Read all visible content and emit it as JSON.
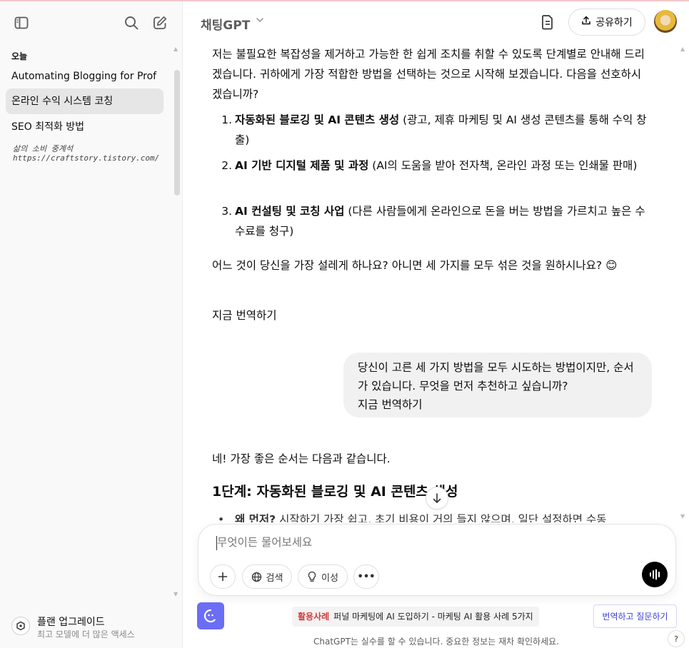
{
  "sidebar": {
    "section_today": "오늘",
    "items": [
      {
        "label": "Automating Blogging for Prof"
      },
      {
        "label": "온라인 수익 시스템 코칭"
      },
      {
        "label": "SEO 최적화 방법"
      }
    ],
    "watermark_line1": "삶의 소비 중계석",
    "watermark_line2": "https://craftstory.tistory.com/",
    "upgrade_title": "플랜 업그레이드",
    "upgrade_sub": "최고 모델에 더 많은 액세스"
  },
  "header": {
    "model": "채팅GPT",
    "share_label": "공유하기"
  },
  "chat": {
    "intro": "저는 불필요한 복잡성을 제거하고 가능한 한 쉽게 조치를 취할 수 있도록 단계별로 안내해 드리겠습니다. 귀하에게 가장 적합한 방법을 선택하는 것으로 시작해 보겠습니다. 다음을 선호하시겠습니까?",
    "options": [
      {
        "num": "1.",
        "bold": "자동화된 블로깅 및 AI 콘텐츠 생성",
        "rest": " (광고, 제휴 마케팅 및 AI 생성 콘텐츠를 통해 수익 창출)"
      },
      {
        "num": "2.",
        "bold": "AI 기반 디지털 제품 및 과정",
        "rest": " (AI의 도움을 받아 전자책, 온라인 과정 또는 인쇄물 판매)"
      },
      {
        "num": "3.",
        "bold": "AI 컨설팅 및 코칭 사업",
        "rest": " (다른 사람들에게 온라인으로 돈을 버는 방법을 가르치고 높은 수수료를 청구)"
      }
    ],
    "question": "어느 것이 당신을 가장 설레게 하나요? 아니면 세 가지를 모두 섞은 것을 원하시나요? 😊",
    "translate_now_1": "지금 번역하기",
    "user_message": "당신이 고른 세 가지 방법을 모두 시도하는 방법이지만, 순서가 있습니다. 무엇을 먼저 추천하고 싶습니까?",
    "translate_now_2": "지금 번역하기",
    "answer_intro": "네! 가장 좋은 순서는 다음과 같습니다.",
    "step_heading": "1단계: 자동화된 블로깅 및 AI 콘텐츠 생성",
    "bullet_bold": "왜 먼저?",
    "bullet_rest": " 시작하기 가장 쉽고, 초기 비용이 거의 들지 않으며, 일단 설정하면 수동"
  },
  "composer": {
    "placeholder": "무엇이든 물어보세요",
    "search_label": "검색",
    "reason_label": "이성"
  },
  "promo": {
    "tag": "활용사례",
    "text": "퍼널 마케팅에 AI 도입하기 - 마케팅 AI 활용 사례 5가지"
  },
  "translate_ask_label": "번역하고 질문하기",
  "disclaimer": "ChatGPT는 실수를 할 수 있습니다. 중요한 정보는 재차 확인하세요.",
  "help_label": "?"
}
